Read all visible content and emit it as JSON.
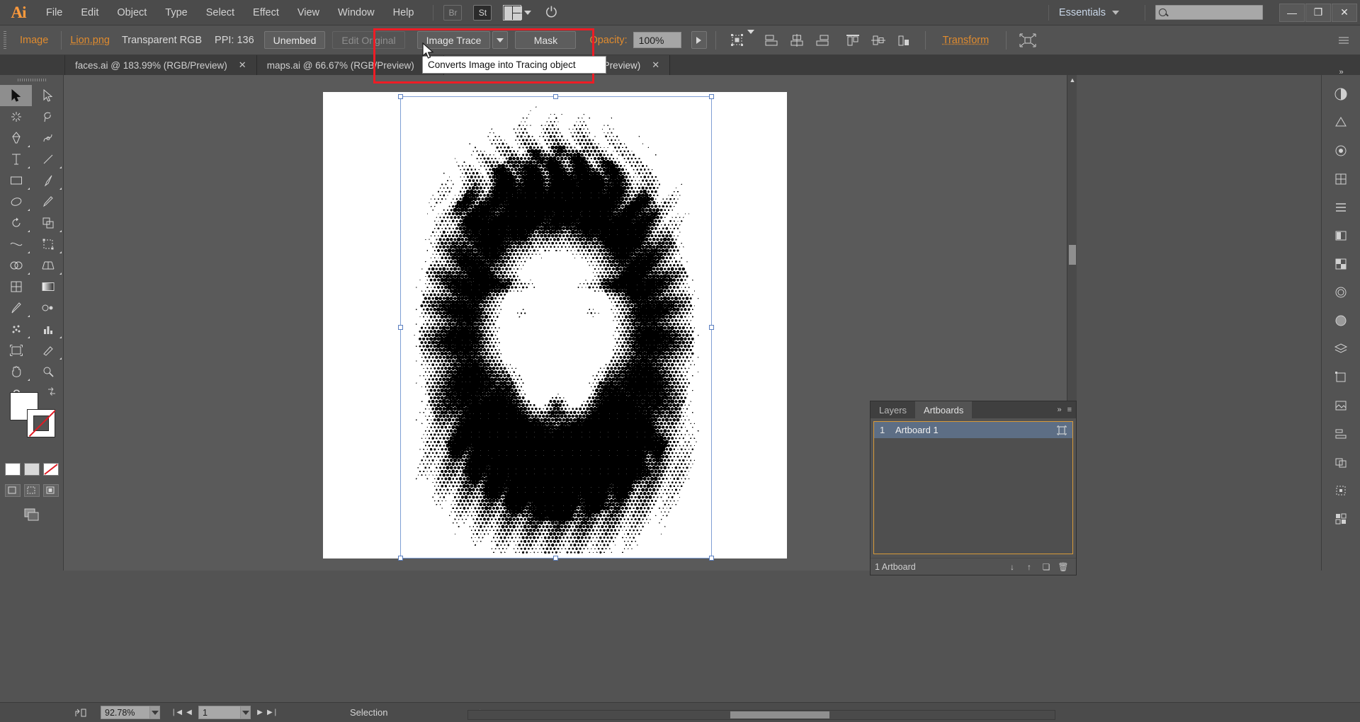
{
  "app": {
    "name": "Ai",
    "title": "Adobe Illustrator"
  },
  "menu": {
    "items": [
      "File",
      "Edit",
      "Object",
      "Type",
      "Select",
      "Effect",
      "View",
      "Window",
      "Help"
    ],
    "bridge_label": "Br",
    "stock_label": "St",
    "arrange_label": "arrange-documents",
    "rocket_label": "sync-settings"
  },
  "workspace": {
    "label": "Essentials",
    "caret": "▾"
  },
  "search": {
    "placeholder": "",
    "value": "",
    "icon": "search-icon"
  },
  "window_controls": {
    "minimize": "—",
    "restore": "❐",
    "close": "✕"
  },
  "control_bar": {
    "context_label": "Image",
    "file_link": "Lion.png",
    "color_mode": "Transparent RGB",
    "ppi": "PPI: 136",
    "unembed_label": "Unembed",
    "edit_original_label": "Edit Original",
    "image_trace_label": "Image Trace",
    "image_trace_caret": "▾",
    "mask_label": "Mask",
    "opacity_label": "Opacity:",
    "opacity_value": "100%",
    "opacity_more": "▶",
    "transform_label": "Transform",
    "align_icons": [
      "align-selection-icon",
      "align-left-icon",
      "align-center-h-icon",
      "align-right-icon",
      "align-top-icon",
      "align-middle-v-icon",
      "align-bottom-icon"
    ],
    "shape_icon": "shape-options-icon",
    "overflow_icon": "panel-menu-icon"
  },
  "tooltip": {
    "text": "Converts Image into Tracing object"
  },
  "highlight_color": "#ee1c25",
  "tabs": [
    {
      "label": "faces.ai @ 183.99% (RGB/Preview)",
      "active": false,
      "close": "✕"
    },
    {
      "label": "maps.ai @ 66.67% (RGB/Preview)",
      "active": false,
      "close": "✕"
    },
    {
      "label": "preview_images* @ 92.78% (RGB/Preview)",
      "active": true,
      "close": "✕"
    }
  ],
  "toolbar": {
    "tools": [
      {
        "name": "selection-tool",
        "glyph": "➤",
        "selected": true
      },
      {
        "name": "direct-selection-tool",
        "glyph": "➤",
        "selected": false
      },
      {
        "name": "magic-wand-tool",
        "glyph": "✶",
        "selected": false
      },
      {
        "name": "lasso-tool",
        "glyph": "⊂",
        "selected": false
      },
      {
        "name": "pen-tool",
        "glyph": "✒",
        "selected": false
      },
      {
        "name": "curvature-tool",
        "glyph": "✎",
        "selected": false
      },
      {
        "name": "type-tool",
        "glyph": "T",
        "selected": false
      },
      {
        "name": "line-segment-tool",
        "glyph": "╱",
        "selected": false
      },
      {
        "name": "rectangle-tool",
        "glyph": "▭",
        "selected": false
      },
      {
        "name": "paintbrush-tool",
        "glyph": "✐",
        "selected": false
      },
      {
        "name": "shaper-tool",
        "glyph": "◔",
        "selected": false
      },
      {
        "name": "pencil-tool",
        "glyph": "✒",
        "selected": false
      },
      {
        "name": "rotate-tool",
        "glyph": "↻",
        "selected": false
      },
      {
        "name": "scale-tool",
        "glyph": "⧉",
        "selected": false
      },
      {
        "name": "width-tool",
        "glyph": "≈",
        "selected": false
      },
      {
        "name": "free-transform-tool",
        "glyph": "⌗",
        "selected": false
      },
      {
        "name": "shape-builder-tool",
        "glyph": "◑",
        "selected": false
      },
      {
        "name": "perspective-grid-tool",
        "glyph": "◤",
        "selected": false
      },
      {
        "name": "mesh-tool",
        "glyph": "⊞",
        "selected": false
      },
      {
        "name": "gradient-tool",
        "glyph": "▤",
        "selected": false
      },
      {
        "name": "eyedropper-tool",
        "glyph": "✁",
        "selected": false
      },
      {
        "name": "blend-tool",
        "glyph": "❀",
        "selected": false
      },
      {
        "name": "symbol-sprayer-tool",
        "glyph": "⚇",
        "selected": false
      },
      {
        "name": "column-graph-tool",
        "glyph": "◫",
        "selected": false
      },
      {
        "name": "artboard-tool",
        "glyph": "⬚",
        "selected": false
      },
      {
        "name": "slice-tool",
        "glyph": "✂",
        "selected": false
      },
      {
        "name": "hand-tool",
        "glyph": "✋",
        "selected": false
      },
      {
        "name": "zoom-tool",
        "glyph": "⌕",
        "selected": false
      }
    ],
    "help_glyph": "?",
    "fill_color": "#ffffff",
    "stroke_color": "#ffffff",
    "none_color": "#e01b24",
    "mini_swatches": [
      "white-fill-swatch",
      "gradient-swatch",
      "none-swatch"
    ],
    "draw_modes": [
      "draw-normal-icon",
      "draw-behind-icon",
      "draw-inside-icon"
    ],
    "screen_mode": "change-screen-mode-icon"
  },
  "canvas": {
    "document_name": "preview_images",
    "artwork_alt": "halftone lion head illustration",
    "selection": "image-bounding-box"
  },
  "right_dock": {
    "icons": [
      "color-panel-icon",
      "color-guide-icon",
      "brushes-panel-icon",
      "symbols-panel-icon",
      "stroke-panel-icon",
      "gradient-panel-icon",
      "transparency-panel-icon",
      "appearance-panel-icon",
      "graphic-styles-panel-icon",
      "layers-panel-icon",
      "artboards-panel-icon",
      "links-panel-icon",
      "align-panel-icon",
      "pathfinder-panel-icon",
      "transform-panel-icon",
      "libraries-panel-icon"
    ],
    "collapse": "»"
  },
  "panel": {
    "tabs": [
      {
        "label": "Layers",
        "active": false
      },
      {
        "label": "Artboards",
        "active": true
      }
    ],
    "expand_icon": "»",
    "menu_icon": "≡",
    "rows": [
      {
        "number": "1",
        "name": "Artboard 1",
        "icon": "artboard-options-icon",
        "selected": true
      }
    ],
    "footer_label": "1 Artboard",
    "footer_icons": [
      "move-down-icon",
      "move-up-icon",
      "new-artboard-icon",
      "delete-artboard-icon"
    ]
  },
  "status_bar": {
    "share_icon": "share-on-behance-icon",
    "zoom_value": "92.78%",
    "zoom_caret": "▾",
    "nav_first": "❘◀",
    "nav_prev": "◀",
    "page_value": "1",
    "page_caret": "▾",
    "nav_next": "▶",
    "nav_last": "▶❘",
    "status_text": "Selection",
    "status_caret": "▶"
  }
}
